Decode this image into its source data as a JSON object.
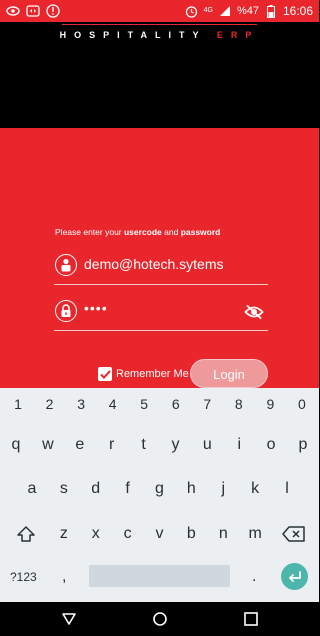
{
  "status_bar": {
    "icons_left": [
      "eye-icon",
      "screen-cast-icon",
      "alert-icon"
    ],
    "alarm_icon": "alarm-icon",
    "network": "4G",
    "battery": "%47",
    "time": "16:06"
  },
  "header": {
    "brand_main": "HOSPITALITY",
    "brand_accent": "ERP"
  },
  "login": {
    "instructions_prefix": "Please enter your ",
    "instructions_user": "usercode",
    "instructions_and": " and ",
    "instructions_pass": "password",
    "username_value": "demo@hotech.sytems",
    "password_value": "••••",
    "remember_label": "Remember Me",
    "remember_checked": true,
    "login_label": "Login"
  },
  "keyboard": {
    "numbers": [
      "1",
      "2",
      "3",
      "4",
      "5",
      "6",
      "7",
      "8",
      "9",
      "0"
    ],
    "row1": [
      "q",
      "w",
      "e",
      "r",
      "t",
      "y",
      "u",
      "i",
      "o",
      "p"
    ],
    "row2": [
      "a",
      "s",
      "d",
      "f",
      "g",
      "h",
      "j",
      "k",
      "l"
    ],
    "row3": [
      "z",
      "x",
      "c",
      "v",
      "b",
      "n",
      "m"
    ],
    "symbols_label": "?123",
    "comma": ",",
    "period": "."
  },
  "colors": {
    "accent": "#e8262b",
    "enter": "#4db6ac"
  }
}
